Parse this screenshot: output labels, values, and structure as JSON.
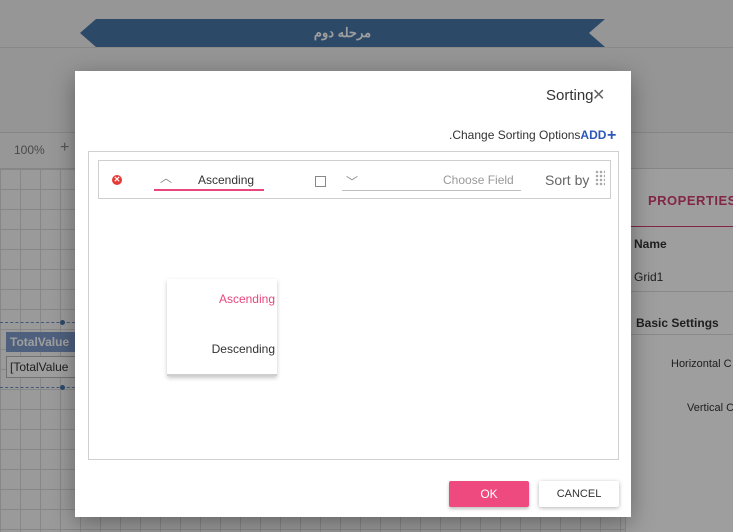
{
  "background": {
    "stage_banner": "مرحله دوم",
    "zoom": "100%",
    "grid_widget": {
      "header": "TotalValue",
      "cell": "[TotalValue"
    },
    "properties": {
      "title": "PROPERTIES",
      "name_label": "Name",
      "name_value": "Grid1",
      "basic_settings": "Basic Settings",
      "horizontal": "Horizontal C",
      "vertical": "Vertical C"
    }
  },
  "dialog": {
    "title": "Sorting",
    "add_link": {
      "add_word": "ADD",
      "text": ".Change Sorting Options"
    },
    "sort_row": {
      "order_value": "Ascending",
      "field_placeholder": "Choose Field",
      "sort_by_label": "Sort by"
    },
    "dropdown": {
      "options": [
        "Ascending",
        "Descending"
      ],
      "selected": "Ascending"
    },
    "buttons": {
      "ok": "OK",
      "cancel": "CANCEL"
    }
  },
  "colors": {
    "accent": "#ef4a80",
    "link": "#2d57b8",
    "banner": "#4a77a8",
    "remove": "#e53935"
  },
  "icons": {
    "close": "close-icon",
    "plus": "plus-icon",
    "remove": "remove-circle-icon",
    "chevron_up": "chevron-up-icon",
    "chevron_down": "chevron-down-icon",
    "drag": "drag-handle-icon"
  }
}
